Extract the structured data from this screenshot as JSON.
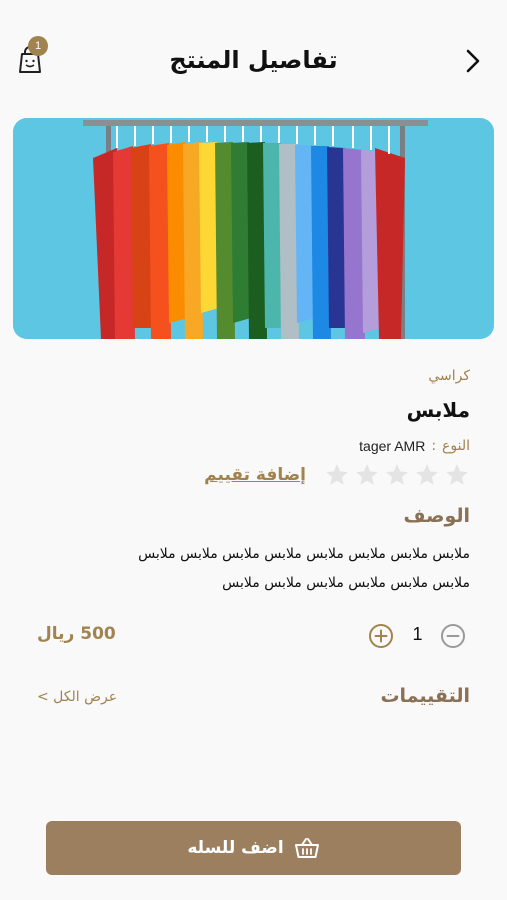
{
  "header": {
    "title": "تفاصيل المنتج",
    "cart_count": "1"
  },
  "product": {
    "category": "كراسي",
    "name": "ملابس",
    "type_label": "النوع",
    "type_separator": ":",
    "type_value": "tager AMR",
    "rating": 0,
    "rating_max": 5,
    "add_rating_label": "إضافة تقييم",
    "description_title": "الوصف",
    "description_line1": "ملابس ملابس ملابس ملابس ملابس ملابس ملابس ملابس",
    "description_line2": "ملابس ملابس ملابس ملابس ملابس ملابس",
    "price": "500 ريال",
    "quantity": "1"
  },
  "reviews": {
    "title": "التقييمات",
    "view_all": "عرض الكل >"
  },
  "footer": {
    "add_to_cart_label": "اضف للسله"
  },
  "colors": {
    "accent": "#a0834e",
    "button": "#9c7f5f",
    "heading_brown": "#8a7055",
    "star_empty": "#e4e4e4",
    "image_bg": "#5dc6e3"
  }
}
